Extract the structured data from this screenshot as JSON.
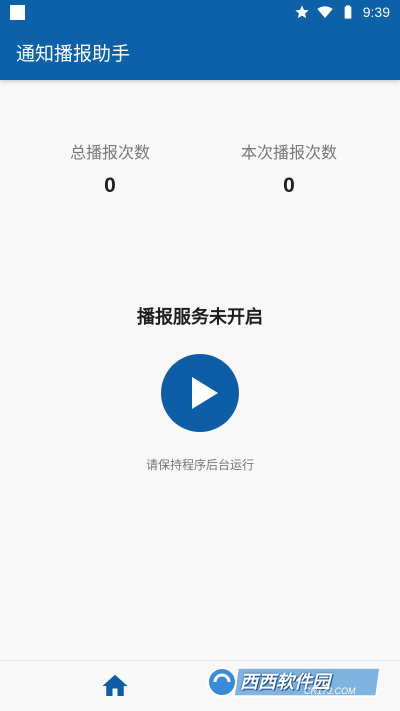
{
  "status_bar": {
    "time": "9:39",
    "icons": [
      "notification-square-icon",
      "star-icon",
      "wifi-icon",
      "battery-icon"
    ]
  },
  "app_bar": {
    "title": "通知播报助手"
  },
  "stats": {
    "total_label": "总播报次数",
    "total_value": "0",
    "current_label": "本次播报次数",
    "current_value": "0"
  },
  "service": {
    "status_text": "播报服务未开启",
    "button_icon": "play-icon",
    "hint": "请保持程序后台运行"
  },
  "bottom_nav": {
    "items": [
      {
        "icon": "home-icon"
      }
    ]
  },
  "watermark": {
    "text": "西西软件园",
    "sub": "CR173.COM"
  },
  "colors": {
    "primary": "#0d61a9",
    "button": "#0d5ea6",
    "background": "#f8f8f8",
    "label": "#777777",
    "value": "#222222"
  }
}
